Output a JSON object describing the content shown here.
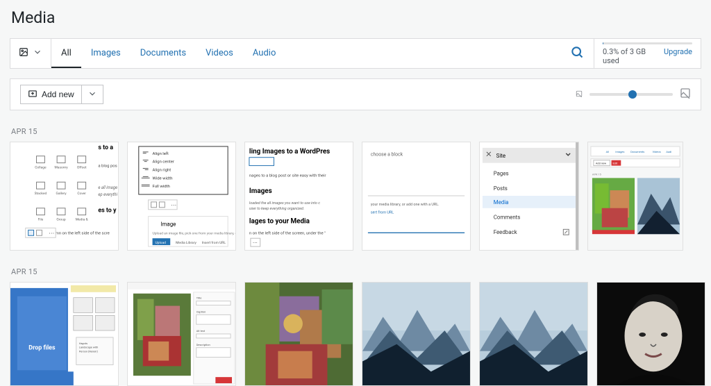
{
  "page": {
    "title": "Media"
  },
  "tabs": {
    "all": "All",
    "images": "Images",
    "documents": "Documents",
    "videos": "Videos",
    "audio": "Audio"
  },
  "storage": {
    "percent": "0.3%",
    "used_text": "0.3% of 3 GB used",
    "upgrade": "Upgrade"
  },
  "toolbar": {
    "add_new": "Add new"
  },
  "groups": {
    "g1_date": "APR 15",
    "g2_date": "APR 15"
  },
  "thumb_labels": {
    "t1_1": "ling Images to a WordPres",
    "t1_2": "choose a block",
    "t1_3_a": "Images",
    "t1_3_b": "lages to your Media",
    "t1_4_site": "Site",
    "t1_4_pages": "Pages",
    "t1_4_posts": "Posts",
    "t1_4_media": "Media",
    "t1_4_comments": "Comments",
    "t1_4_feedback": "Feedback",
    "t2_1": "Drop files"
  },
  "colors": {
    "accent": "#2271b1"
  }
}
